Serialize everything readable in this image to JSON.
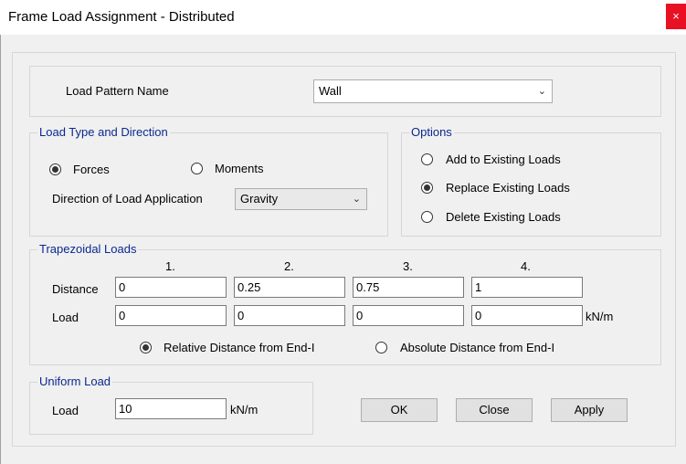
{
  "window": {
    "title": "Frame Load Assignment - Distributed",
    "close_glyph": "×"
  },
  "load_pattern": {
    "label": "Load Pattern Name",
    "value": "Wall"
  },
  "load_type": {
    "group_title": "Load Type and Direction",
    "forces_label": "Forces",
    "moments_label": "Moments",
    "selected": "Forces",
    "direction_label": "Direction of Load Application",
    "direction_value": "Gravity"
  },
  "options": {
    "group_title": "Options",
    "add_label": "Add to Existing Loads",
    "replace_label": "Replace Existing Loads",
    "delete_label": "Delete Existing Loads",
    "selected": "Replace Existing Loads"
  },
  "trapezoidal": {
    "group_title": "Trapezoidal Loads",
    "columns": [
      "1.",
      "2.",
      "3.",
      "4."
    ],
    "distance_label": "Distance",
    "load_label": "Load",
    "distances": [
      "0",
      "0.25",
      "0.75",
      "1"
    ],
    "loads": [
      "0",
      "0",
      "0",
      "0"
    ],
    "unit": "kN/m",
    "relative_label": "Relative Distance from End-I",
    "absolute_label": "Absolute Distance from End-I",
    "selected": "Relative Distance from End-I"
  },
  "uniform": {
    "group_title": "Uniform Load",
    "load_label": "Load",
    "value": "10",
    "unit": "kN/m"
  },
  "buttons": {
    "ok": "OK",
    "close": "Close",
    "apply": "Apply"
  },
  "colors": {
    "group_title": "#0a2890",
    "close_button": "#e81123"
  }
}
